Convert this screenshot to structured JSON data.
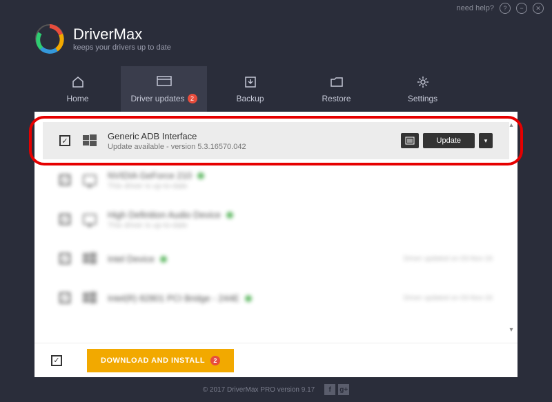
{
  "topbar": {
    "help": "need help?"
  },
  "brand": {
    "name": "DriverMax",
    "tagline": "keeps your drivers up to date"
  },
  "tabs": [
    {
      "label": "Home"
    },
    {
      "label": "Driver updates",
      "badge": "2"
    },
    {
      "label": "Backup"
    },
    {
      "label": "Restore"
    },
    {
      "label": "Settings"
    }
  ],
  "rows": {
    "featured": {
      "title": "Generic ADB Interface",
      "sub": "Update available - version 5.3.16570.042",
      "update_btn": "Update"
    },
    "others": [
      {
        "title": "NVIDIA GeForce 210",
        "sub": "This driver is up-to-date"
      },
      {
        "title": "High Definition Audio Device",
        "sub": "This driver is up-to-date"
      },
      {
        "title": "Intel Device",
        "sub": "",
        "right": "Driver updated on 03-Nov-16"
      },
      {
        "title": "Intel(R) 82801 PCI Bridge - 244E",
        "sub": "",
        "right": "Driver updated on 03-Nov-16"
      }
    ]
  },
  "download_btn": {
    "label": "DOWNLOAD AND INSTALL",
    "badge": "2"
  },
  "footer": {
    "copy": "© 2017 DriverMax PRO version 9.17"
  }
}
